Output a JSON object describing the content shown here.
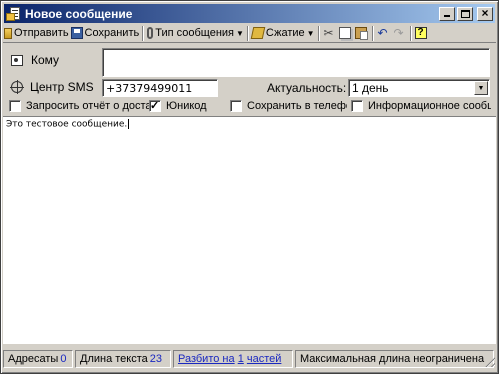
{
  "window": {
    "title": "Новое сообщение"
  },
  "toolbar": {
    "send_label": "Отправить",
    "save_label": "Сохранить",
    "message_type_label": "Тип сообщения",
    "compression_label": "Сжатие"
  },
  "recipient": {
    "to_label": "Кому",
    "to_value": ""
  },
  "sms_center": {
    "label": "Центр SMS",
    "value": "+37379499011"
  },
  "validity": {
    "label": "Актуальность:",
    "selected": "1 день"
  },
  "options": {
    "request_report": {
      "label": "Запросить отчёт о доставке",
      "checked": false
    },
    "unicode": {
      "label": "Юникод",
      "checked": true
    },
    "save_to_phone": {
      "label": "Сохранить в телефоне",
      "checked": false
    },
    "info_message": {
      "label": "Информационное сообщение",
      "checked": false
    }
  },
  "message": {
    "text": "Это тестовое сообщение."
  },
  "statusbar": {
    "recipients_label": "Адресаты",
    "recipients_count": "0",
    "text_length_label": "Длина текста",
    "text_length_value": "23",
    "split_prefix": "Разбито на",
    "split_count": "1",
    "split_suffix": "частей",
    "max_length_text": "Максимальная длина неограничена"
  },
  "icons": {
    "send": "send-icon",
    "save": "save-icon",
    "message_type": "paperclip-icon",
    "compression": "compress-icon",
    "cut": "cut-icon",
    "copy": "copy-icon",
    "paste": "paste-icon",
    "undo": "undo-icon",
    "redo": "redo-icon",
    "help": "help-icon"
  },
  "colors": {
    "titlebar_start": "#0a246a",
    "titlebar_end": "#a6caf0",
    "link": "#1a28c0",
    "face": "#d4d0c8"
  }
}
